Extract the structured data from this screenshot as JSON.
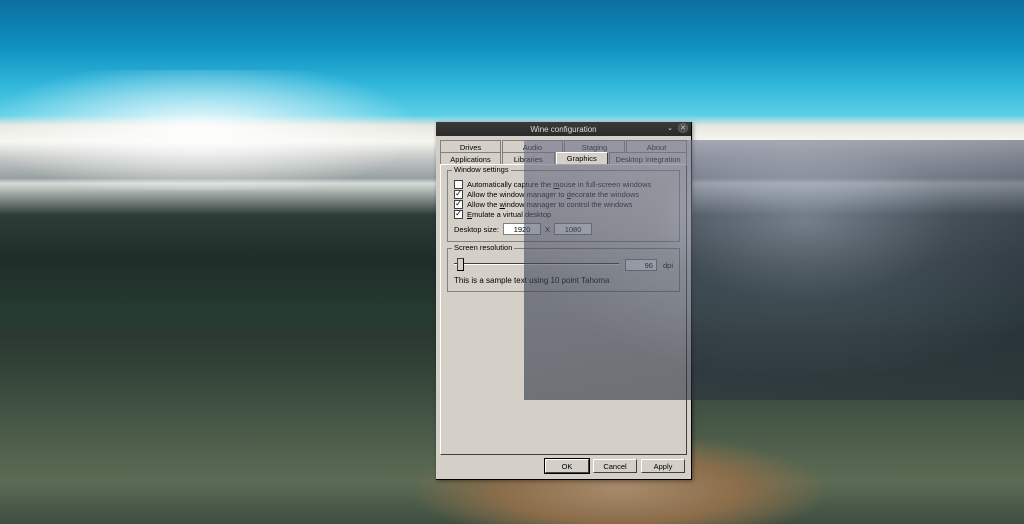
{
  "window": {
    "title": "Wine configuration"
  },
  "tabs_row1": [
    {
      "label": "Drives"
    },
    {
      "label": "Audio"
    },
    {
      "label": "Staging"
    },
    {
      "label": "About"
    }
  ],
  "tabs_row2": [
    {
      "label": "Applications"
    },
    {
      "label": "Libraries"
    },
    {
      "label": "Graphics"
    },
    {
      "label": "Desktop Integration"
    }
  ],
  "active_tab": "Graphics",
  "group_window": {
    "legend": "Window settings",
    "chk_mouse": {
      "label": "Automatically capture the mouse in full-screen windows",
      "checked": false
    },
    "chk_decorate": {
      "label": "Allow the window manager to decorate the windows",
      "checked": true
    },
    "chk_control": {
      "label": "Allow the window manager to control the windows",
      "checked": true
    },
    "chk_virtual": {
      "label": "Emulate a virtual desktop",
      "checked": true
    },
    "desktop_size_label": "Desktop size:",
    "width": "1920",
    "by": "X",
    "height": "1080"
  },
  "group_res": {
    "legend": "Screen resolution",
    "dpi_value": "96",
    "dpi_label": "dpi",
    "sample": "This is a sample text using 10 point Tahoma"
  },
  "buttons": {
    "ok": "OK",
    "cancel": "Cancel",
    "apply": "Apply"
  }
}
